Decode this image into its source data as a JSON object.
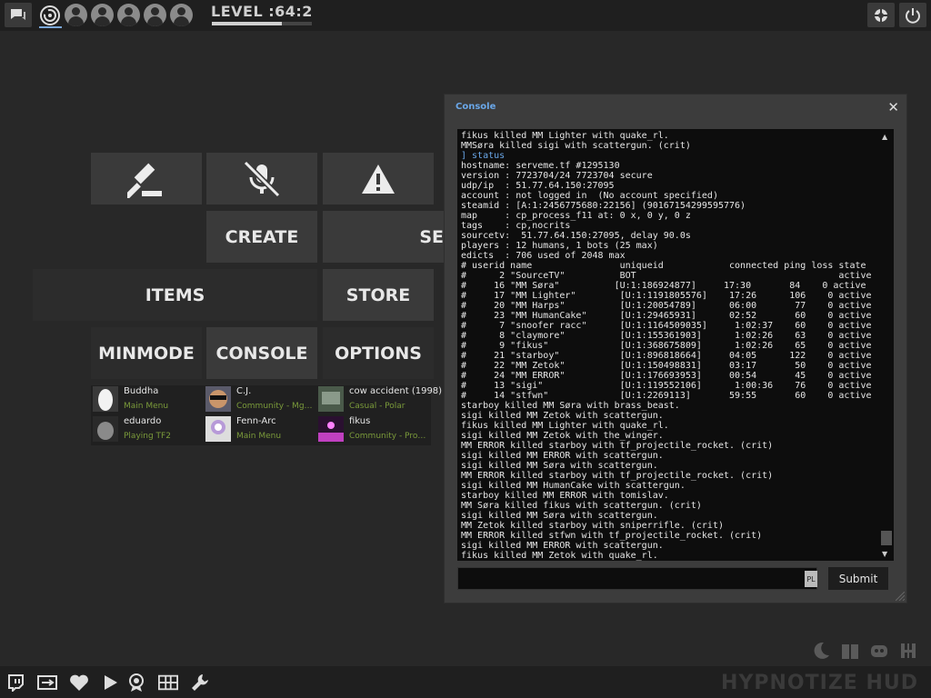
{
  "topbar": {
    "level_text": "LEVEL :64:2",
    "level_progress": 0.7
  },
  "menu": {
    "create": "CREATE",
    "servers_partial": "SE",
    "items": "ITEMS",
    "store": "STORE",
    "minmode": "MINMODE",
    "console": "CONSOLE",
    "options": "OPTIONS"
  },
  "friends": [
    {
      "name": "Buddha",
      "status": "Main Menu"
    },
    {
      "name": "C.J.",
      "status": "Community - Mge T..."
    },
    {
      "name": "cow accident (1998)",
      "status": "Casual - Polar"
    },
    {
      "name": "eduardo",
      "status": "Playing TF2"
    },
    {
      "name": "Fenn-Arc",
      "status": "Main Menu"
    },
    {
      "name": "fikus",
      "status": "Community - Proce..."
    }
  ],
  "console": {
    "title": "Console",
    "close": "✕",
    "pl_label": "PL",
    "submit": "Submit",
    "lines": [
      {
        "t": "fikus killed MM Lighter with quake_rl."
      },
      {
        "t": "MMSøra killed sigi with scattergun. (crit)"
      },
      {
        "t": "] status",
        "cmd": true
      },
      {
        "t": "hostname: serveme.tf #1295130"
      },
      {
        "t": "version : 7723704/24 7723704 secure"
      },
      {
        "t": "udp/ip  : 51.77.64.150:27095"
      },
      {
        "t": "account : not logged in  (No account specified)"
      },
      {
        "t": "steamid : [A:1:2456775680:22156] (90167154299595776)"
      },
      {
        "t": "map     : cp_process_f11 at: 0 x, 0 y, 0 z"
      },
      {
        "t": "tags    : cp,nocrits"
      },
      {
        "t": "sourcetv:  51.77.64.150:27095, delay 90.0s"
      },
      {
        "t": "players : 12 humans, 1 bots (25 max)"
      },
      {
        "t": "edicts  : 706 used of 2048 max"
      },
      {
        "t": "# userid name                uniqueid            connected ping loss state"
      },
      {
        "t": "#      2 \"SourceTV\"          BOT                                     active"
      },
      {
        "t": "#     16 \"MM Søra\"          [U:1:186924877]     17:30       84    0 active"
      },
      {
        "t": "#     17 \"MM Lighter\"        [U:1:1191805576]    17:26      106    0 active"
      },
      {
        "t": "#     20 \"MM Harps\"          [U:1:20054789]      06:00       77    0 active"
      },
      {
        "t": "#     23 \"MM HumanCake\"      [U:1:29465931]      02:52       60    0 active"
      },
      {
        "t": "#      7 \"snoofer racc\"      [U:1:1164509035]     1:02:37    60    0 active"
      },
      {
        "t": "#      8 \"claymore\"          [U:1:155361903]      1:02:26    63    0 active"
      },
      {
        "t": "#      9 \"fikus\"             [U:1:368675809]      1:02:26    65    0 active"
      },
      {
        "t": "#     21 \"starboy\"           [U:1:896818664]     04:05      122    0 active"
      },
      {
        "t": "#     22 \"MM Zetok\"          [U:1:150498831]     03:17       50    0 active"
      },
      {
        "t": "#     24 \"MM ERROR\"          [U:1:176693953]     00:54       45    0 active"
      },
      {
        "t": "#     13 \"sigi\"              [U:1:119552106]      1:00:36    76    0 active"
      },
      {
        "t": "#     14 \"stfwn\"             [U:1:2269113]       59:55       60    0 active"
      },
      {
        "t": "starboy killed MM Søra with brass_beast."
      },
      {
        "t": "sigi killed MM Zetok with scattergun."
      },
      {
        "t": "fikus killed MM Lighter with quake_rl."
      },
      {
        "t": "sigi killed MM Zetok with the_winger."
      },
      {
        "t": "MM ERROR killed starboy with tf_projectile_rocket. (crit)"
      },
      {
        "t": "sigi killed MM ERROR with scattergun."
      },
      {
        "t": "sigi killed MM Søra with scattergun."
      },
      {
        "t": "MM ERROR killed starboy with tf_projectile_rocket. (crit)"
      },
      {
        "t": "sigi killed MM HumanCake with scattergun."
      },
      {
        "t": "starboy killed MM ERROR with tomislav."
      },
      {
        "t": "MM Søra killed fikus with scattergun. (crit)"
      },
      {
        "t": "sigi killed MM Søra with scattergun."
      },
      {
        "t": "MM Zetok killed starboy with sniperrifle. (crit)"
      },
      {
        "t": "MM ERROR killed stfwn with tf_projectile_rocket. (crit)"
      },
      {
        "t": "sigi killed MM ERROR with scattergun."
      },
      {
        "t": "fikus killed MM Zetok with quake_rl."
      }
    ]
  },
  "bottombar": {
    "brand": "HYPNOTIZE HUD"
  },
  "colors": {
    "accent": "#6aa7e8",
    "status_green": "#7a9a3a"
  }
}
